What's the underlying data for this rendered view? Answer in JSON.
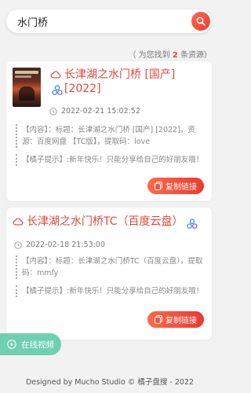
{
  "search": {
    "query": "水门桥"
  },
  "result_count": {
    "prefix": "（ 为您找到 ",
    "count": "2",
    "suffix": " 条资源）"
  },
  "results": [
    {
      "title": "长津湖之水门桥 [国产] [2022]",
      "date": "2022-02-21 15:02:52",
      "content": "【内容】：标题：长津湖之水门桥 [国产] [2022]，资源：百度网盘 【TC版】，提取码：love",
      "tip": "【橘子提示】:新年快乐！只能分享给自己的好朋友哦！",
      "copy_label": "复制链接"
    },
    {
      "title": "长津湖之水门桥TC（百度云盘）",
      "date": "2022-02-18 21:53:00",
      "content": "【内容】：标题：长津湖之水门桥TC（百度云盘），提取码：mmfy",
      "tip": "【橘子提示】:新年快乐！只能分享给自己的好朋友哦！",
      "copy_label": "复制链接"
    }
  ],
  "video_button": {
    "label": "在线视频"
  },
  "footer": {
    "text": "Designed by Mucho Studio © 橘子盘搜 - 2022"
  },
  "colors": {
    "accent": "#e4473b",
    "video": "#6fcfb1",
    "share": "#3b8fe0"
  },
  "icons": [
    "search-icon",
    "cloud-icon",
    "share-icon",
    "clock-icon",
    "copy-icon",
    "play-icon"
  ]
}
